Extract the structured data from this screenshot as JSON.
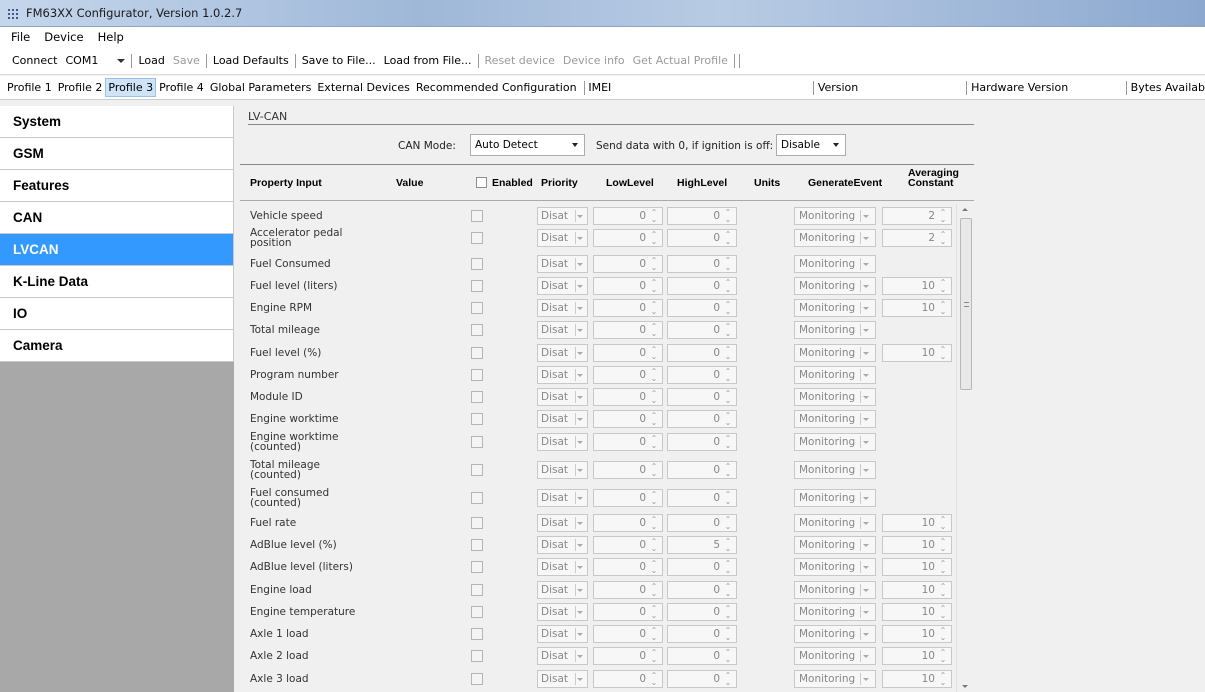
{
  "window": {
    "title": "FM63XX Configurator, Version 1.0.2.7"
  },
  "menu": [
    "File",
    "Device",
    "Help"
  ],
  "toolbar": {
    "connect_label": "Connect",
    "port": "COM1",
    "load": "Load",
    "save": "Save",
    "load_defaults": "Load Defaults",
    "save_to_file": "Save to File...",
    "load_from_file": "Load from File...",
    "reset_device": "Reset device",
    "device_info": "Device info",
    "get_actual_profile": "Get Actual Profile"
  },
  "tabs": {
    "items": [
      "Profile 1",
      "Profile 2",
      "Profile 3",
      "Profile 4",
      "Global Parameters",
      "External Devices",
      "Recommended Configuration"
    ],
    "active": "Profile 3",
    "imei_label": "IMEI",
    "version_label": "Version",
    "hardware_version_label": "Hardware Version",
    "bytes_label": "Bytes Availab"
  },
  "sidebar": {
    "items": [
      "System",
      "GSM",
      "Features",
      "CAN",
      "LVCAN",
      "K-Line Data",
      "IO",
      "Camera"
    ],
    "active": "LVCAN"
  },
  "section": {
    "title": "LV-CAN",
    "can_mode_label": "CAN Mode:",
    "can_mode_value": "Auto Detect",
    "send_zero_label": "Send data with 0, if ignition is off:",
    "send_zero_value": "Disable"
  },
  "table": {
    "headers": {
      "property": "Property Input",
      "value": "Value",
      "enabled": "Enabled",
      "priority": "Priority",
      "low": "LowLevel",
      "high": "HighLevel",
      "units": "Units",
      "event": "GenerateEvent",
      "avg_line1": "Averaging",
      "avg_line2": "Constant"
    },
    "rows": [
      {
        "name": "Vehicle speed",
        "priority": "Disat",
        "low": "0",
        "high": "0",
        "event": "Monitoring",
        "avg": "2"
      },
      {
        "name": "Accelerator pedal position",
        "priority": "Disat",
        "low": "0",
        "high": "0",
        "event": "Monitoring",
        "avg": "2"
      },
      {
        "name": "Fuel Consumed",
        "priority": "Disat",
        "low": "0",
        "high": "0",
        "event": "Monitoring",
        "avg": null
      },
      {
        "name": "Fuel level (liters)",
        "priority": "Disat",
        "low": "0",
        "high": "0",
        "event": "Monitoring",
        "avg": "10"
      },
      {
        "name": "Engine RPM",
        "priority": "Disat",
        "low": "0",
        "high": "0",
        "event": "Monitoring",
        "avg": "10"
      },
      {
        "name": "Total mileage",
        "priority": "Disat",
        "low": "0",
        "high": "0",
        "event": "Monitoring",
        "avg": null
      },
      {
        "name": "Fuel level (%)",
        "priority": "Disat",
        "low": "0",
        "high": "0",
        "event": "Monitoring",
        "avg": "10"
      },
      {
        "name": "Program number",
        "priority": "Disat",
        "low": "0",
        "high": "0",
        "event": "Monitoring",
        "avg": null
      },
      {
        "name": "Module ID",
        "priority": "Disat",
        "low": "0",
        "high": "0",
        "event": "Monitoring",
        "avg": null
      },
      {
        "name": "Engine worktime",
        "priority": "Disat",
        "low": "0",
        "high": "0",
        "event": "Monitoring",
        "avg": null
      },
      {
        "name": "Engine worktime (counted)",
        "priority": "Disat",
        "low": "0",
        "high": "0",
        "event": "Monitoring",
        "avg": null
      },
      {
        "name": "Total mileage (counted)",
        "priority": "Disat",
        "low": "0",
        "high": "0",
        "event": "Monitoring",
        "avg": null
      },
      {
        "name": "Fuel consumed (counted)",
        "priority": "Disat",
        "low": "0",
        "high": "0",
        "event": "Monitoring",
        "avg": null
      },
      {
        "name": "Fuel rate",
        "priority": "Disat",
        "low": "0",
        "high": "0",
        "event": "Monitoring",
        "avg": "10"
      },
      {
        "name": "AdBlue level (%)",
        "priority": "Disat",
        "low": "0",
        "high": "5",
        "event": "Monitoring",
        "avg": "10"
      },
      {
        "name": "AdBlue level (liters)",
        "priority": "Disat",
        "low": "0",
        "high": "0",
        "event": "Monitoring",
        "avg": "10"
      },
      {
        "name": "Engine load",
        "priority": "Disat",
        "low": "0",
        "high": "0",
        "event": "Monitoring",
        "avg": "10"
      },
      {
        "name": "Engine temperature",
        "priority": "Disat",
        "low": "0",
        "high": "0",
        "event": "Monitoring",
        "avg": "10"
      },
      {
        "name": "Axle 1 load",
        "priority": "Disat",
        "low": "0",
        "high": "0",
        "event": "Monitoring",
        "avg": "10"
      },
      {
        "name": "Axle 2 load",
        "priority": "Disat",
        "low": "0",
        "high": "0",
        "event": "Monitoring",
        "avg": "10"
      },
      {
        "name": "Axle 3 load",
        "priority": "Disat",
        "low": "0",
        "high": "0",
        "event": "Monitoring",
        "avg": "10"
      }
    ]
  }
}
